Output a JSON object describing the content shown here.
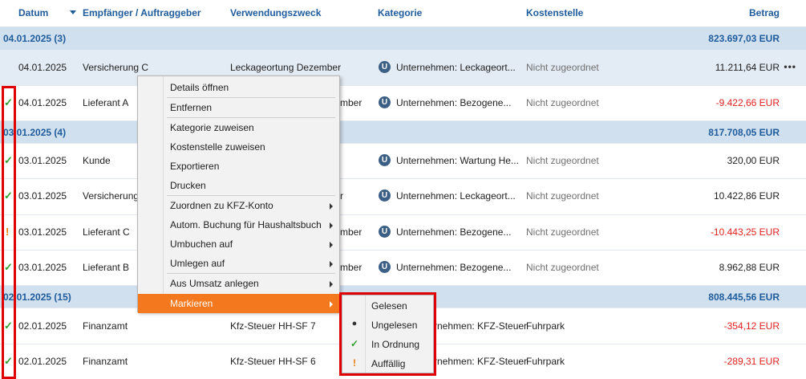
{
  "header": {
    "datum": "Datum",
    "empfaenger": "Empfänger / Auftraggeber",
    "verwendungszweck": "Verwendungszweck",
    "kategorie": "Kategorie",
    "kostenstelle": "Kostenstelle",
    "betrag": "Betrag"
  },
  "groups": [
    {
      "label": "04.01.2025 (3)",
      "sum": "823.697,03 EUR"
    },
    {
      "label": "03.01.2025 (4)",
      "sum": "817.708,05 EUR"
    },
    {
      "label": "02.01.2025 (15)",
      "sum": "808.445,56 EUR"
    }
  ],
  "rows": [
    {
      "date": "04.01.2025",
      "payee": "Versicherung C",
      "purpose": "Leckageortung Dezember",
      "category": "Unternehmen: Leckageort...",
      "cost": "Nicht zugeordnet",
      "amount": "11.211,64 EUR",
      "flag": "",
      "more": "•••"
    },
    {
      "date": "04.01.2025",
      "payee": "Lieferant A",
      "purpose": "mber",
      "category": "Unternehmen: Bezogene...",
      "cost": "Nicht zugeordnet",
      "amount": "-9.422,66 EUR",
      "flag": "✓"
    },
    {
      "date": "03.01.2025",
      "payee": "Kunde",
      "purpose": "",
      "category": "Unternehmen: Wartung He...",
      "cost": "Nicht zugeordnet",
      "amount": "320,00 EUR",
      "flag": "✓"
    },
    {
      "date": "03.01.2025",
      "payee": "Versicherung",
      "purpose": "r",
      "category": "Unternehmen: Leckageort...",
      "cost": "Nicht zugeordnet",
      "amount": "10.422,86 EUR",
      "flag": "✓"
    },
    {
      "date": "03.01.2025",
      "payee": "Lieferant C",
      "purpose": "mber",
      "category": "Unternehmen: Bezogene...",
      "cost": "Nicht zugeordnet",
      "amount": "-10.443,25 EUR",
      "flag": "!"
    },
    {
      "date": "03.01.2025",
      "payee": "Lieferant B",
      "purpose": "mber",
      "category": "Unternehmen: Bezogene...",
      "cost": "Nicht zugeordnet",
      "amount": "8.962,88 EUR",
      "flag": "✓"
    },
    {
      "date": "02.01.2025",
      "payee": "Finanzamt",
      "purpose": "Kfz-Steuer HH-SF 7",
      "category": "rnehmen: KFZ-Steuer",
      "cost": "Fuhrpark",
      "amount": "-354,12 EUR",
      "flag": "✓"
    },
    {
      "date": "02.01.2025",
      "payee": "Finanzamt",
      "purpose": "Kfz-Steuer HH-SF 6",
      "category": "rnehmen: KFZ-Steuer",
      "cost": "Fuhrpark",
      "amount": "-289,31 EUR",
      "flag": "✓"
    }
  ],
  "category_icon": "U",
  "context_menu": [
    "Details öffnen",
    "Entfernen",
    "Kategorie zuweisen",
    "Kostenstelle zuweisen",
    "Exportieren",
    "Drucken",
    "Zuordnen zu KFZ-Konto",
    "Autom. Buchung für Haushaltsbuch",
    "Umbuchen auf",
    "Umlegen auf",
    "Aus Umsatz anlegen",
    "Markieren"
  ],
  "submenu": [
    {
      "label": "Gelesen",
      "icon": ""
    },
    {
      "label": "Ungelesen",
      "icon": "●"
    },
    {
      "label": "In Ordnung",
      "icon": "✓"
    },
    {
      "label": "Auffällig",
      "icon": "!"
    }
  ],
  "colors": {
    "accent": "#f4781e",
    "header_text": "#1f5c9c",
    "group_bg": "#d1e0ef",
    "negative": "#e02020",
    "highlight_border": "#e00000"
  }
}
